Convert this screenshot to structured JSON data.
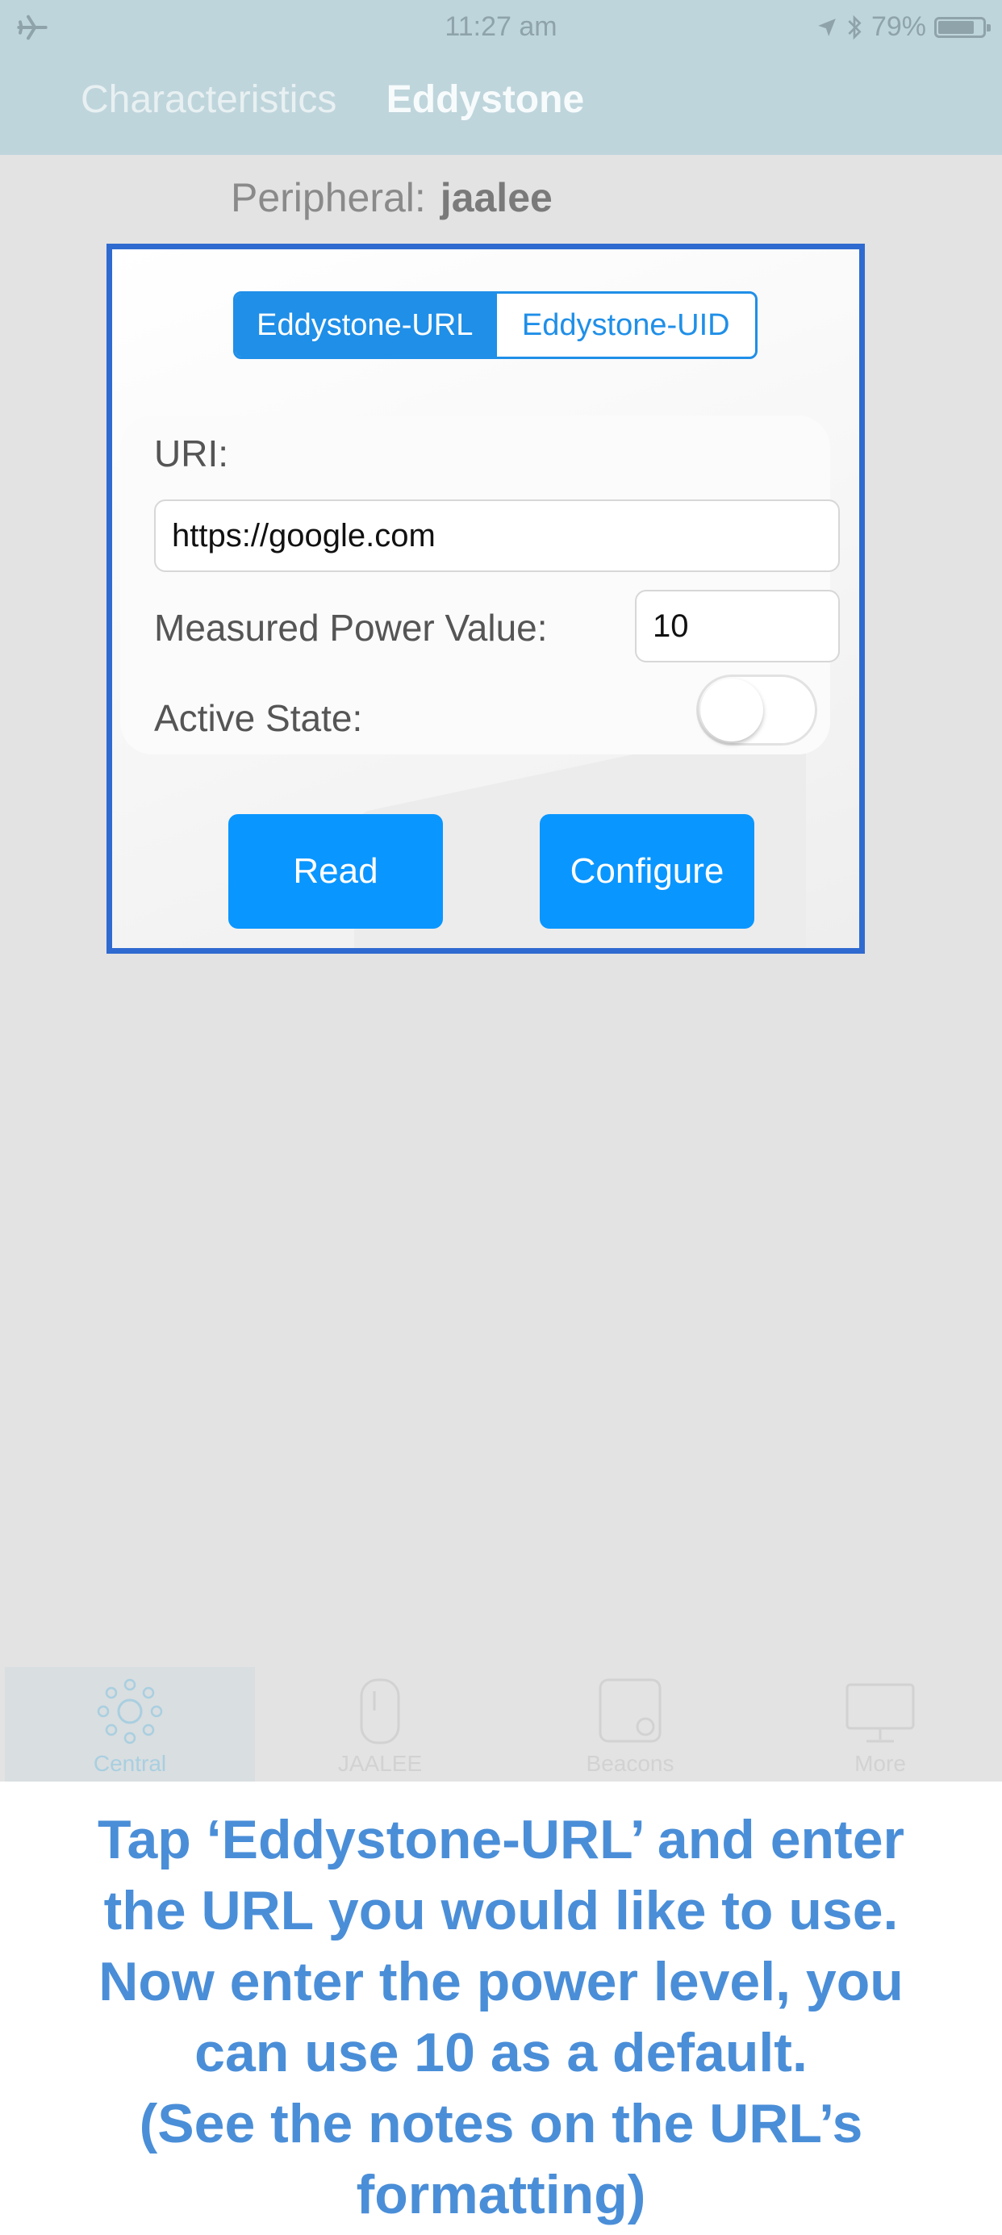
{
  "status_bar": {
    "time": "11:27 am",
    "battery": "79%",
    "battery_level": 0.79
  },
  "nav": {
    "tab_characteristics": "Characteristics",
    "tab_eddystone": "Eddystone"
  },
  "peripheral": {
    "label": "Peripheral:",
    "name": "jaalee"
  },
  "segment": {
    "url": "Eddystone-URL",
    "uid": "Eddystone-UID",
    "selected": "Eddystone-URL"
  },
  "form": {
    "uri_label": "URI:",
    "uri_value": "https://google.com",
    "power_label": "Measured Power Value:",
    "power_value": "10",
    "active_label": "Active State:",
    "active_on": false
  },
  "buttons": {
    "read": "Read",
    "configure": "Configure"
  },
  "tabbar": {
    "central": "Central",
    "jaalee": "JAALEE",
    "beacons": "Beacons",
    "more": "More"
  },
  "instructions": {
    "line1": "Tap ‘Eddystone-URL’ and enter",
    "line2": "the URL you would like to use.",
    "line3": "Now enter the power level, you",
    "line4": "can use 10 as a default.",
    "line5": "(See the notes on the URL’s",
    "line6": "formatting)"
  },
  "colors": {
    "accent": "#0a96ff",
    "highlight_border": "#2f6ad0",
    "instruction_text": "#4a8ed8",
    "nav_bg": "#bfd5dc"
  }
}
